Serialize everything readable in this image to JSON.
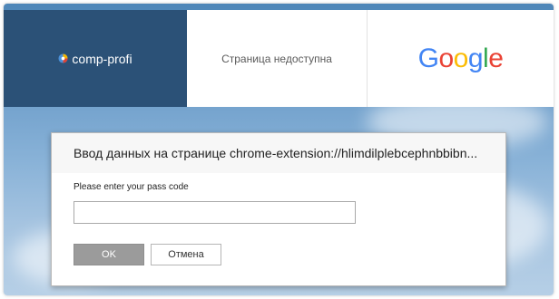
{
  "tiles": [
    {
      "label": "comp-profi",
      "icon": "site-favicon-icon"
    },
    {
      "label": "Страница недоступна"
    },
    {
      "logo": [
        "G",
        "o",
        "o",
        "g",
        "l",
        "e"
      ],
      "logo_colors": [
        "#4285F4",
        "#EA4335",
        "#FBBC05",
        "#4285F4",
        "#34A853",
        "#EA4335"
      ]
    }
  ],
  "dialog": {
    "title": "Ввод данных на странице chrome-extension://hlimdilplebcephnbbibn...",
    "prompt": "Please enter your pass code",
    "input_value": "",
    "ok_label": "OK",
    "cancel_label": "Отмена"
  },
  "colors": {
    "tile_dark": "#2b5177",
    "ok_button": "#9b9b9b",
    "sky_top": "#4e86b8",
    "sky_bottom": "#b6cfe6"
  }
}
